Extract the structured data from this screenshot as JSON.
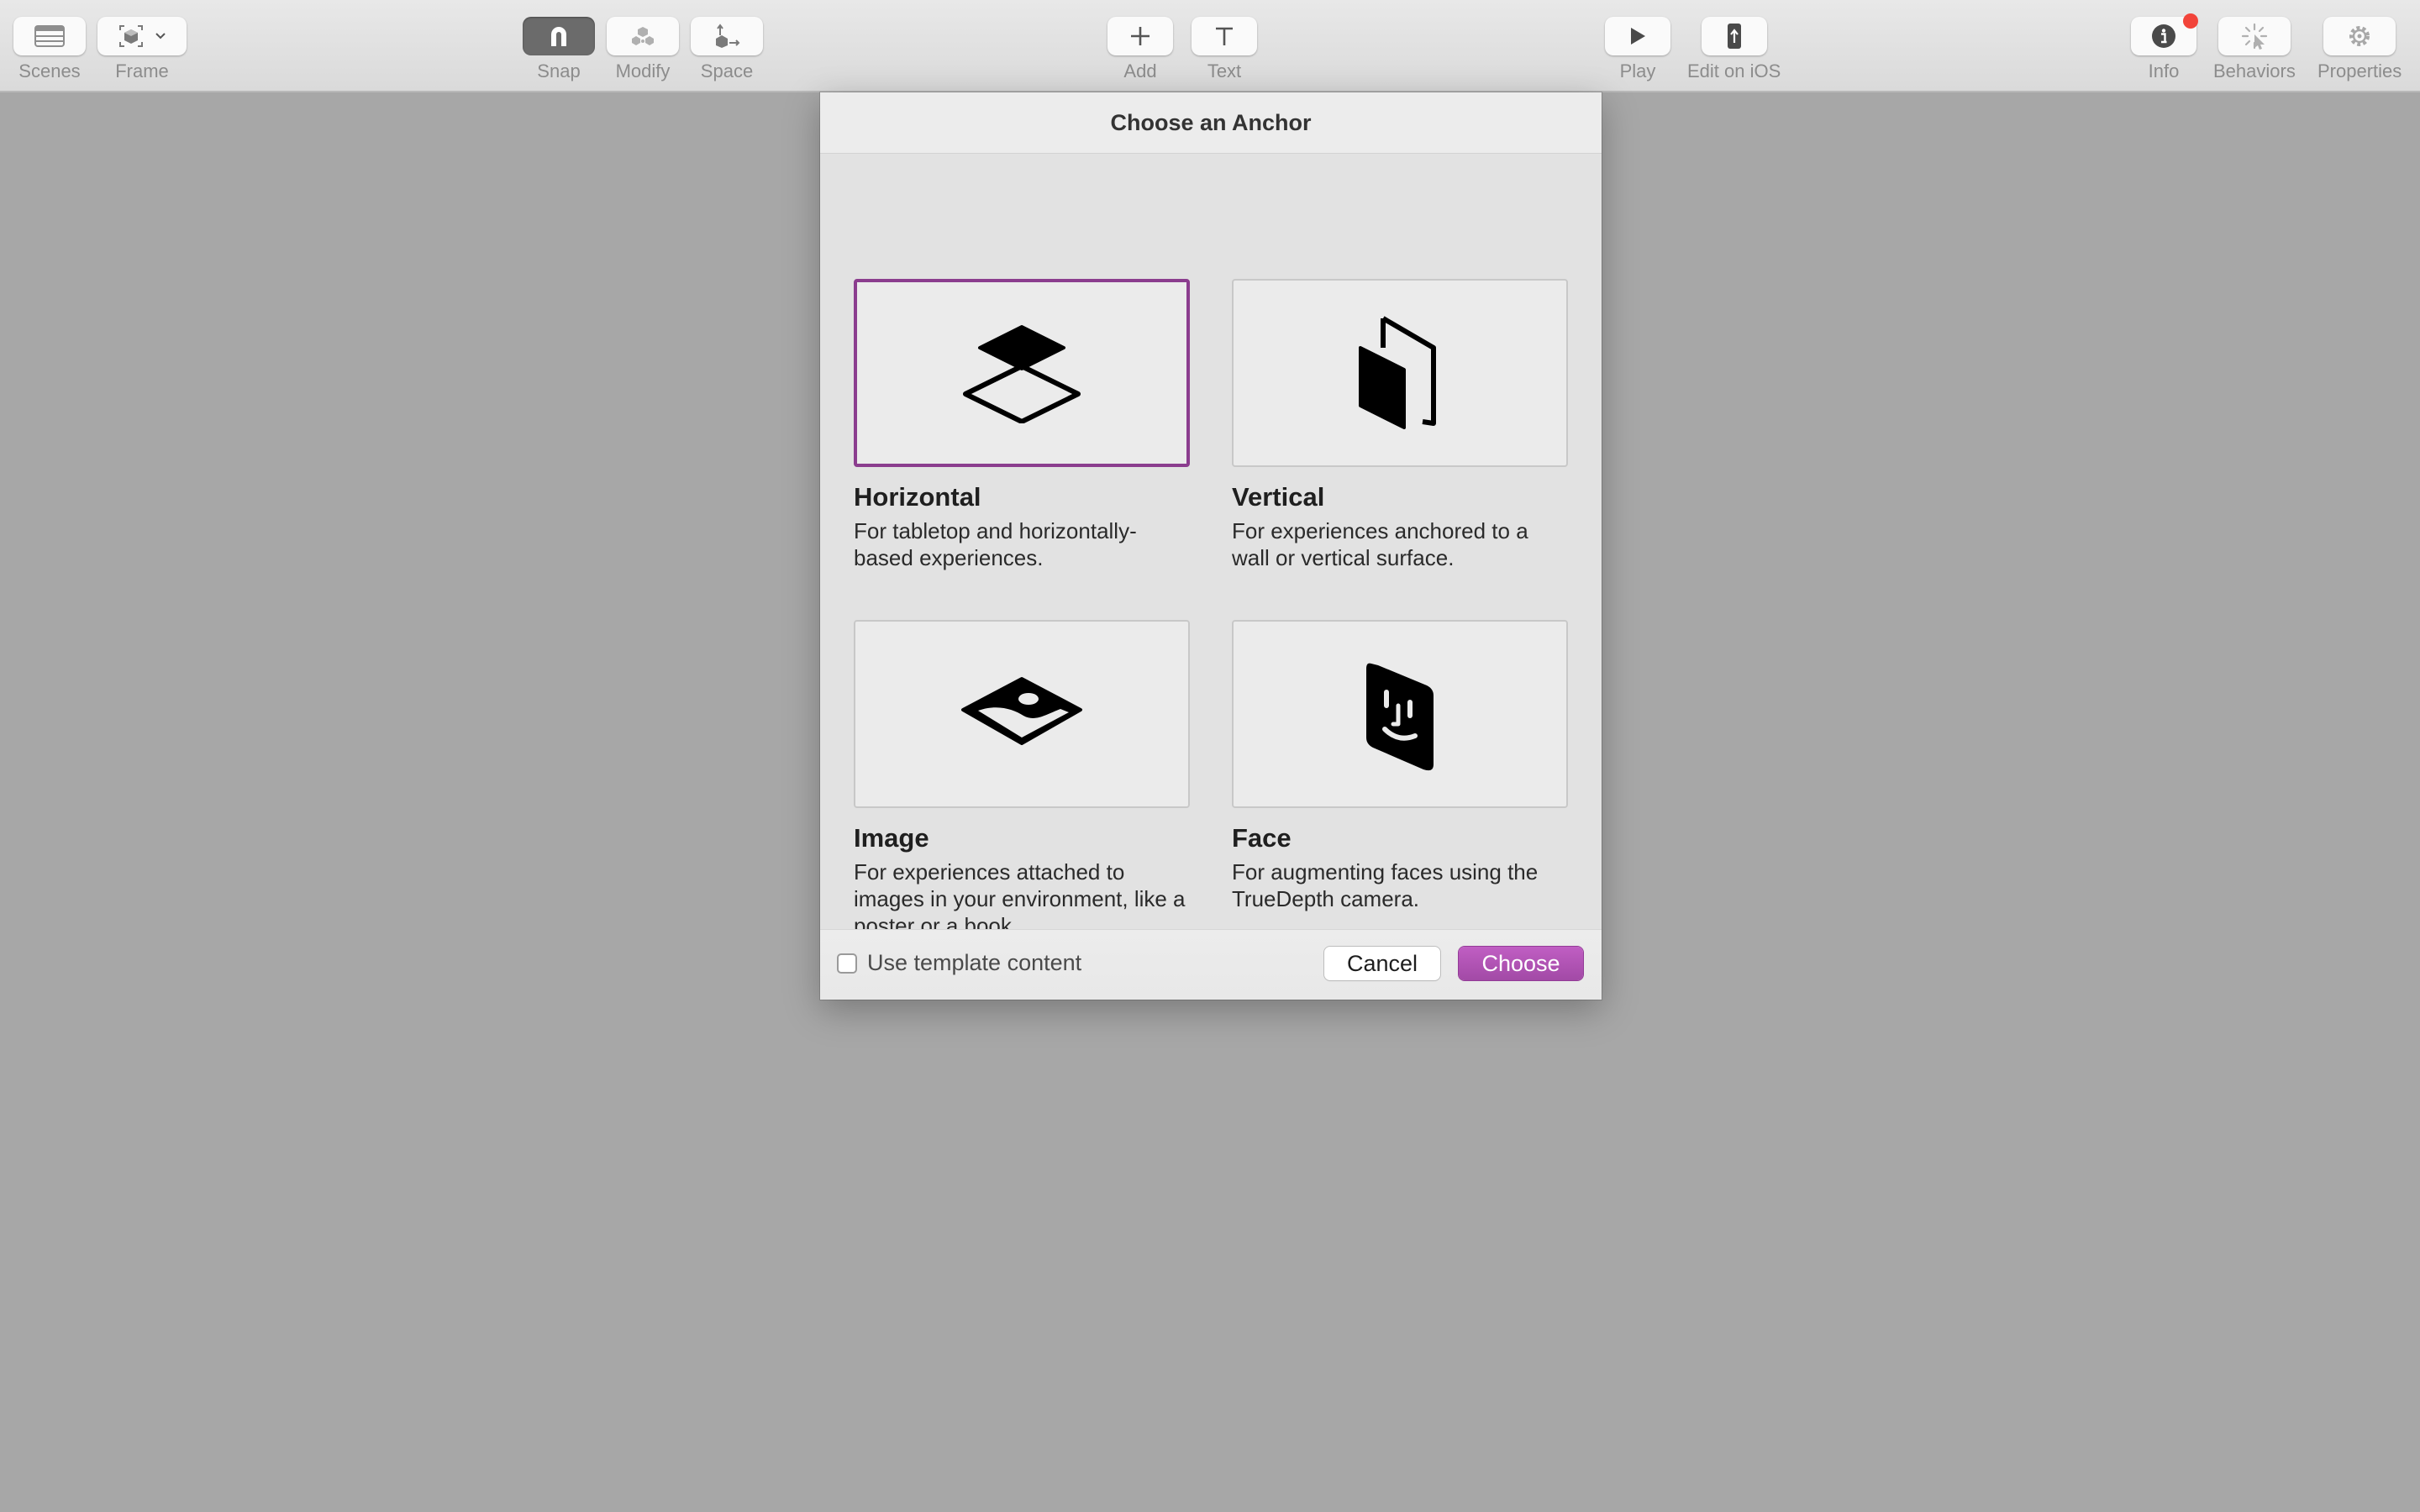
{
  "toolbar": {
    "scenes_label": "Scenes",
    "frame_label": "Frame",
    "snap_label": "Snap",
    "modify_label": "Modify",
    "space_label": "Space",
    "add_label": "Add",
    "text_label": "Text",
    "play_label": "Play",
    "edit_ios_label": "Edit on iOS",
    "info_label": "Info",
    "behaviors_label": "Behaviors",
    "properties_label": "Properties",
    "info_badge_color": "#f2443a",
    "snap_active": true
  },
  "dialog": {
    "title": "Choose an Anchor",
    "cards": [
      {
        "title": "Horizontal",
        "description": "For tabletop and horizontally-based experiences.",
        "icon": "horizontal-plane-icon",
        "selected": true
      },
      {
        "title": "Vertical",
        "description": "For experiences anchored to a wall or vertical surface.",
        "icon": "vertical-plane-icon",
        "selected": false
      },
      {
        "title": "Image",
        "description": "For experiences attached to images in your environment, like a poster or a book.",
        "icon": "image-anchor-icon",
        "selected": false
      },
      {
        "title": "Face",
        "description": "For augmenting faces using the TrueDepth camera.",
        "icon": "face-anchor-icon",
        "selected": false
      }
    ],
    "use_template_label": "Use template content",
    "use_template_checked": false,
    "cancel_label": "Cancel",
    "choose_label": "Choose",
    "accent_color": "#8b3d8e"
  }
}
